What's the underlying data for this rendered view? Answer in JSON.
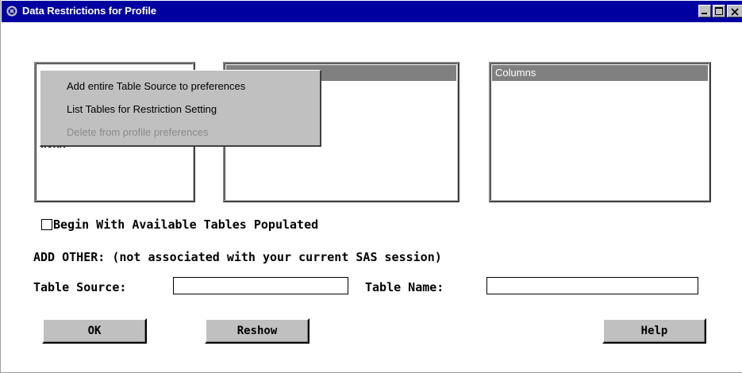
{
  "window": {
    "title": "Data Restrictions for Profile",
    "icon": "sas-icon",
    "controls": [
      "minimize",
      "maximize",
      "close"
    ]
  },
  "libraries": {
    "items": [
      "WORK"
    ]
  },
  "tables": {
    "header": ""
  },
  "columns": {
    "header": "Columns"
  },
  "context_menu": {
    "items": [
      {
        "label": "Add entire Table Source to preferences",
        "enabled": true
      },
      {
        "label": "List Tables for Restriction Setting",
        "enabled": true
      },
      {
        "label": "Delete from profile preferences",
        "enabled": false
      }
    ]
  },
  "options": {
    "begin_populated_label": "Begin With Available Tables Populated",
    "begin_populated_checked": false
  },
  "add_other": {
    "heading": "ADD OTHER: (not associated with your current SAS session)",
    "table_source_label": "Table Source:",
    "table_source_value": "",
    "table_name_label": "Table Name:",
    "table_name_value": ""
  },
  "buttons": {
    "ok": "OK",
    "reshow": "Reshow",
    "help": "Help"
  }
}
